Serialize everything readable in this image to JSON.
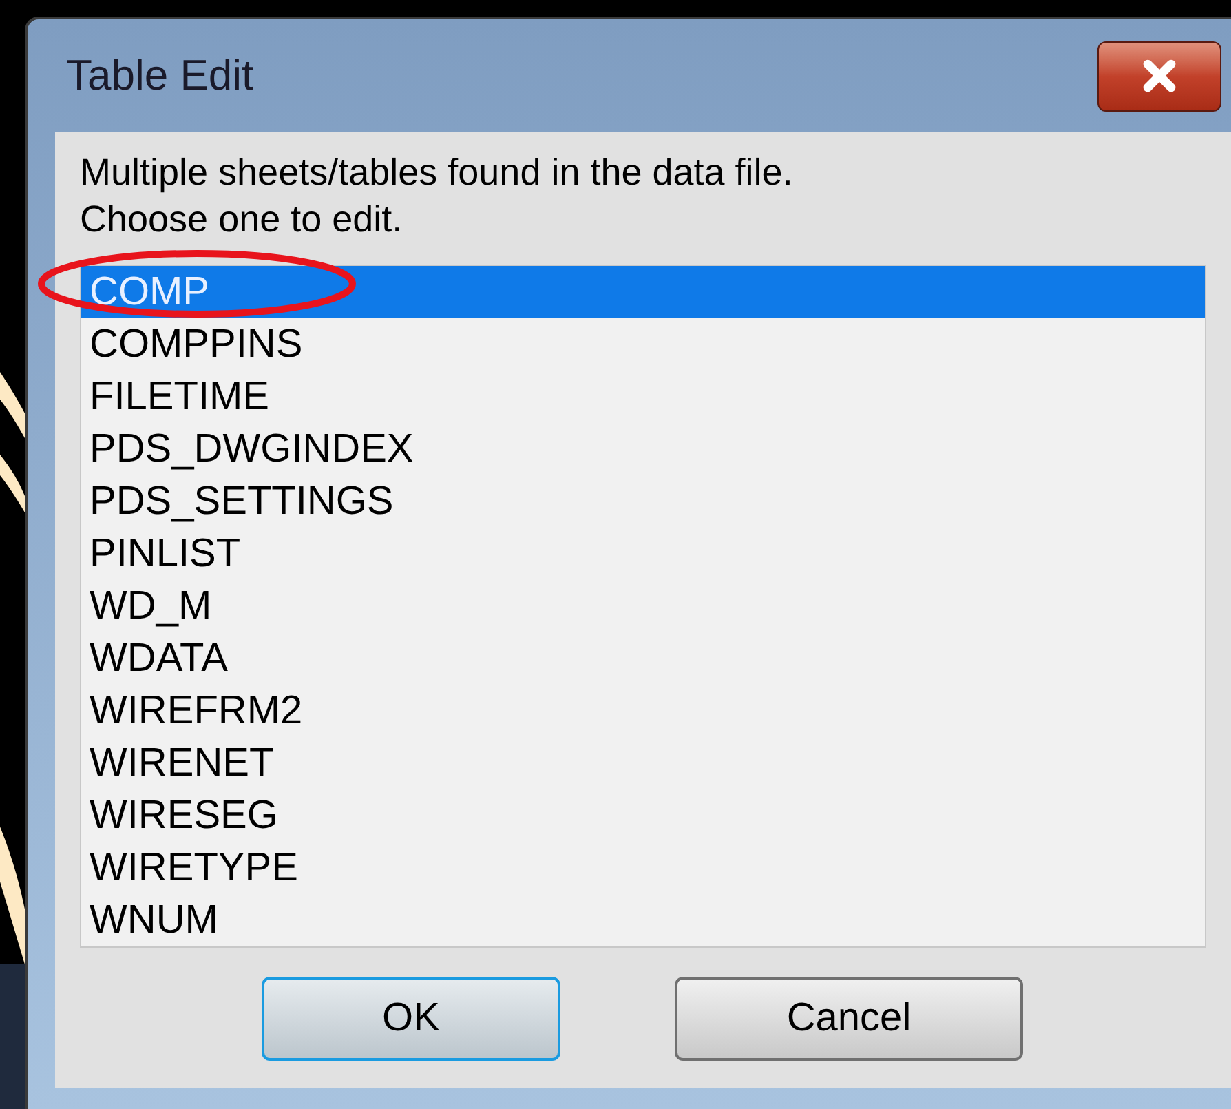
{
  "window": {
    "title": "Table Edit"
  },
  "message": [
    "Multiple sheets/tables found in the data file.",
    "Choose one to edit."
  ],
  "list": [
    {
      "label": "COMP",
      "selected": true
    },
    {
      "label": "COMPPINS",
      "selected": false
    },
    {
      "label": "FILETIME",
      "selected": false
    },
    {
      "label": "PDS_DWGINDEX",
      "selected": false
    },
    {
      "label": "PDS_SETTINGS",
      "selected": false
    },
    {
      "label": "PINLIST",
      "selected": false
    },
    {
      "label": "WD_M",
      "selected": false
    },
    {
      "label": "WDATA",
      "selected": false
    },
    {
      "label": "WIREFRM2",
      "selected": false
    },
    {
      "label": "WIRENET",
      "selected": false
    },
    {
      "label": "WIRESEG",
      "selected": false
    },
    {
      "label": "WIRETYPE",
      "selected": false
    },
    {
      "label": "WNUM",
      "selected": false
    }
  ],
  "buttons": [
    {
      "label": "OK",
      "default": true
    },
    {
      "label": "Cancel",
      "default": false
    }
  ]
}
